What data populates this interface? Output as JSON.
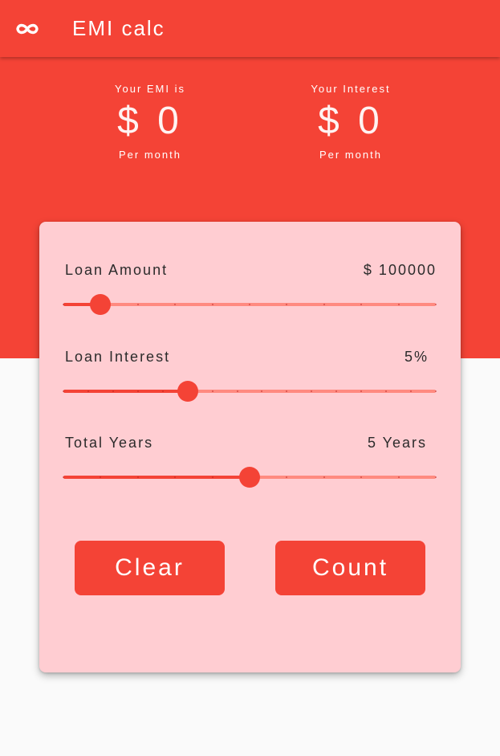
{
  "app": {
    "title": "EMI calc",
    "logo_icon": "infinity-icon"
  },
  "summary": {
    "emi": {
      "caption": "Your EMI is",
      "value": "$ 0",
      "unit": "Per month"
    },
    "interest": {
      "caption": "Your Interest",
      "value": "$ 0",
      "unit": "Per month"
    }
  },
  "form": {
    "loan_amount": {
      "label": "Loan Amount",
      "value": "$ 100000",
      "divisions": 10,
      "fraction": 0.1
    },
    "loan_interest": {
      "label": "Loan Interest",
      "value": "5%",
      "divisions": 15,
      "fraction": 0.3333
    },
    "total_years": {
      "label": "Total Years",
      "value": "5 Years",
      "divisions": 10,
      "fraction": 0.5
    }
  },
  "buttons": {
    "clear": "Clear",
    "count": "Count"
  },
  "colors": {
    "primary": "#f44336",
    "card": "#ffcdd2",
    "track_inactive": "#ff8a80",
    "background": "#fafafa"
  }
}
